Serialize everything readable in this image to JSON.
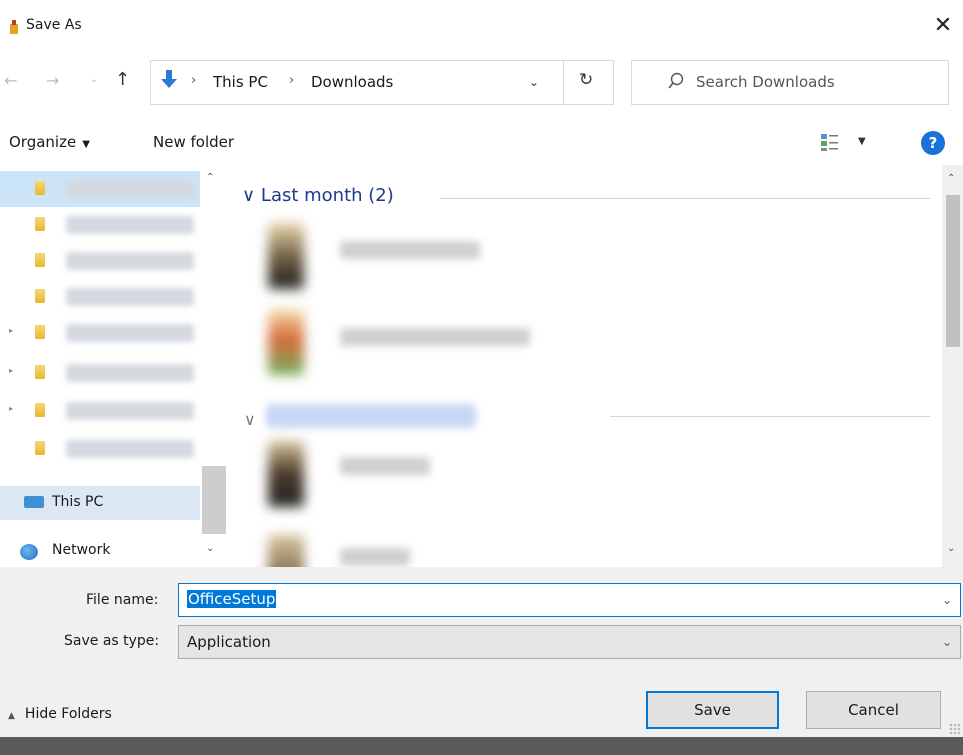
{
  "window": {
    "title": "Save As",
    "close_glyph": "✕"
  },
  "nav": {
    "back_glyph": "←",
    "forward_glyph": "→",
    "recent_glyph": "⌄",
    "up_glyph": "↑"
  },
  "address_bar": {
    "separator": "›",
    "crumbs": [
      "This PC",
      "Downloads"
    ],
    "dropdown_glyph": "⌄",
    "refresh_glyph": "↻"
  },
  "search": {
    "placeholder": "Search Downloads"
  },
  "toolbar": {
    "organize_label": "Organize",
    "organize_caret": "▼",
    "new_folder_label": "New folder",
    "view_caret": "▼",
    "help_label": "?"
  },
  "nav_pane": {
    "folder_count": 8,
    "this_pc_label": "This PC",
    "network_label": "Network",
    "scroll_up": "⌃",
    "scroll_down": "⌄"
  },
  "content": {
    "group_header": "Last month (2)",
    "group_caret": "∨",
    "scroll_up": "⌃",
    "scroll_down": "⌄"
  },
  "form": {
    "file_name_label": "File name:",
    "file_name_value": "OfficeSetup",
    "save_type_label": "Save as type:",
    "save_type_value": "Application",
    "caret": "⌄"
  },
  "footer": {
    "hide_folders_label": "Hide Folders",
    "hide_folders_caret": "▲",
    "save_label": "Save",
    "cancel_label": "Cancel"
  },
  "colors": {
    "accent": "#0078d7",
    "selection": "#cce4f7",
    "group_header": "#1e3a8a"
  }
}
